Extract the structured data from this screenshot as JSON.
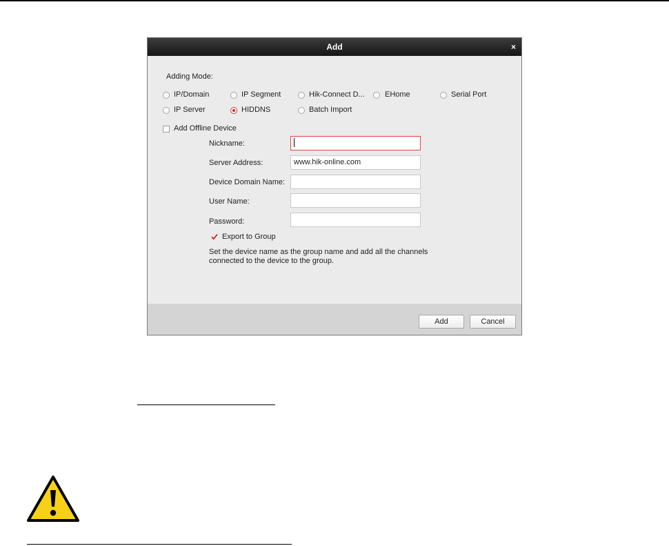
{
  "dialog": {
    "title": "Add",
    "close_glyph": "×",
    "adding_mode_label": "Adding Mode:",
    "modes": [
      {
        "label": "IP/Domain",
        "selected": false
      },
      {
        "label": "IP Segment",
        "selected": false
      },
      {
        "label": "Hik-Connect D...",
        "selected": false
      },
      {
        "label": "EHome",
        "selected": false
      },
      {
        "label": "Serial Port",
        "selected": false
      },
      {
        "label": "IP Server",
        "selected": false
      },
      {
        "label": "HIDDNS",
        "selected": true
      },
      {
        "label": "Batch Import",
        "selected": false
      }
    ],
    "offline_device_label": "Add Offline Device",
    "offline_device_checked": false,
    "fields": {
      "nickname": {
        "label": "Nickname:",
        "value": ""
      },
      "server_address": {
        "label": "Server Address:",
        "value": "www.hik-online.com"
      },
      "domain_name": {
        "label": "Device Domain Name:",
        "value": ""
      },
      "user_name": {
        "label": "User Name:",
        "value": ""
      },
      "password": {
        "label": "Password:",
        "value": ""
      }
    },
    "export_to_group": {
      "label": "Export to Group",
      "checked": true
    },
    "hint": "Set the device name as the group name and add all the channels connected to the device to the group.",
    "buttons": {
      "add": "Add",
      "cancel": "Cancel"
    }
  },
  "colors": {
    "titlebar": "#262626",
    "dialog_bg": "#ebebeb",
    "footer_bg": "#d4d4d4",
    "accent_red": "#d62020",
    "warning_yellow": "#f7d117"
  },
  "icons": [
    "close-icon",
    "warning-icon",
    "checkmark-icon"
  ]
}
